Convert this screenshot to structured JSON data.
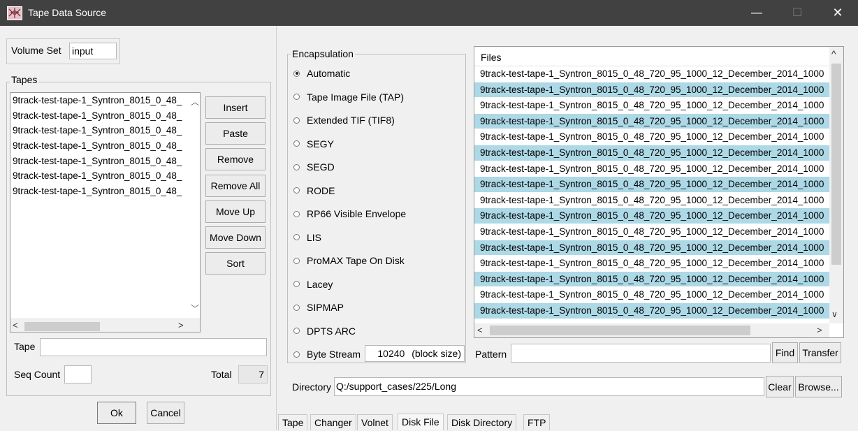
{
  "window": {
    "title": "Tape Data Source",
    "minimize": "—",
    "maximize": "☐",
    "close": "✕"
  },
  "volume_set": {
    "label": "Volume Set",
    "value": "input"
  },
  "tapes": {
    "title": "Tapes",
    "items": [
      "9track-test-tape-1_Syntron_8015_0_48_",
      "9track-test-tape-1_Syntron_8015_0_48_",
      "9track-test-tape-1_Syntron_8015_0_48_",
      "9track-test-tape-1_Syntron_8015_0_48_",
      "9track-test-tape-1_Syntron_8015_0_48_",
      "9track-test-tape-1_Syntron_8015_0_48_",
      "9track-test-tape-1_Syntron_8015_0_48_"
    ],
    "buttons": [
      "Insert",
      "Paste",
      "Remove",
      "Remove All",
      "Move Up",
      "Move Down",
      "Sort"
    ],
    "tape_label": "Tape",
    "tape_value": "",
    "seq_count_label": "Seq Count",
    "seq_count_value": "",
    "total_label": "Total",
    "total_value": "7"
  },
  "dialog_buttons": {
    "ok": "Ok",
    "cancel": "Cancel"
  },
  "encapsulation": {
    "title": "Encapsulation",
    "options": [
      "Automatic",
      "Tape Image File (TAP)",
      "Extended TIF (TIF8)",
      "SEGY",
      "SEGD",
      "RODE",
      "RP66 Visible Envelope",
      "LIS",
      "ProMAX Tape On Disk",
      "Lacey",
      "SIPMAP",
      "DPTS ARC",
      "Byte Stream"
    ],
    "selected": "Automatic",
    "block_size": "10240",
    "block_size_suffix": "(block size)"
  },
  "files": {
    "header": "Files",
    "rows": [
      "9track-test-tape-1_Syntron_8015_0_48_720_95_1000_12_December_2014_1000",
      "9track-test-tape-1_Syntron_8015_0_48_720_95_1000_12_December_2014_1000",
      "9track-test-tape-1_Syntron_8015_0_48_720_95_1000_12_December_2014_1000",
      "9track-test-tape-1_Syntron_8015_0_48_720_95_1000_12_December_2014_1000",
      "9track-test-tape-1_Syntron_8015_0_48_720_95_1000_12_December_2014_1000",
      "9track-test-tape-1_Syntron_8015_0_48_720_95_1000_12_December_2014_1000",
      "9track-test-tape-1_Syntron_8015_0_48_720_95_1000_12_December_2014_1000",
      "9track-test-tape-1_Syntron_8015_0_48_720_95_1000_12_December_2014_1000",
      "9track-test-tape-1_Syntron_8015_0_48_720_95_1000_12_December_2014_1000",
      "9track-test-tape-1_Syntron_8015_0_48_720_95_1000_12_December_2014_1000",
      "9track-test-tape-1_Syntron_8015_0_48_720_95_1000_12_December_2014_1000",
      "9track-test-tape-1_Syntron_8015_0_48_720_95_1000_12_December_2014_1000",
      "9track-test-tape-1_Syntron_8015_0_48_720_95_1000_12_December_2014_1000",
      "9track-test-tape-1_Syntron_8015_0_48_720_95_1000_12_December_2014_1000",
      "9track-test-tape-1_Syntron_8015_0_48_720_95_1000_12_December_2014_1000",
      "9track-test-tape-1_Syntron_8015_0_48_720_95_1000_12_December_2014_1000"
    ],
    "highlight_color": "#add8e6",
    "pattern_label": "Pattern",
    "pattern_value": "",
    "find": "Find",
    "transfer": "Transfer"
  },
  "directory": {
    "label": "Directory",
    "value": "Q:/support_cases/225/Long",
    "clear": "Clear",
    "browse": "Browse..."
  },
  "tabs": [
    "Tape",
    "Changer",
    "Volnet",
    "Disk File",
    "Disk Directory",
    "FTP"
  ],
  "active_tab": "Disk File",
  "icons": {
    "app": "app-grid-icon",
    "scroll_up": "▲",
    "scroll_down": "▼",
    "scroll_left": "◀",
    "scroll_right": "▶"
  }
}
